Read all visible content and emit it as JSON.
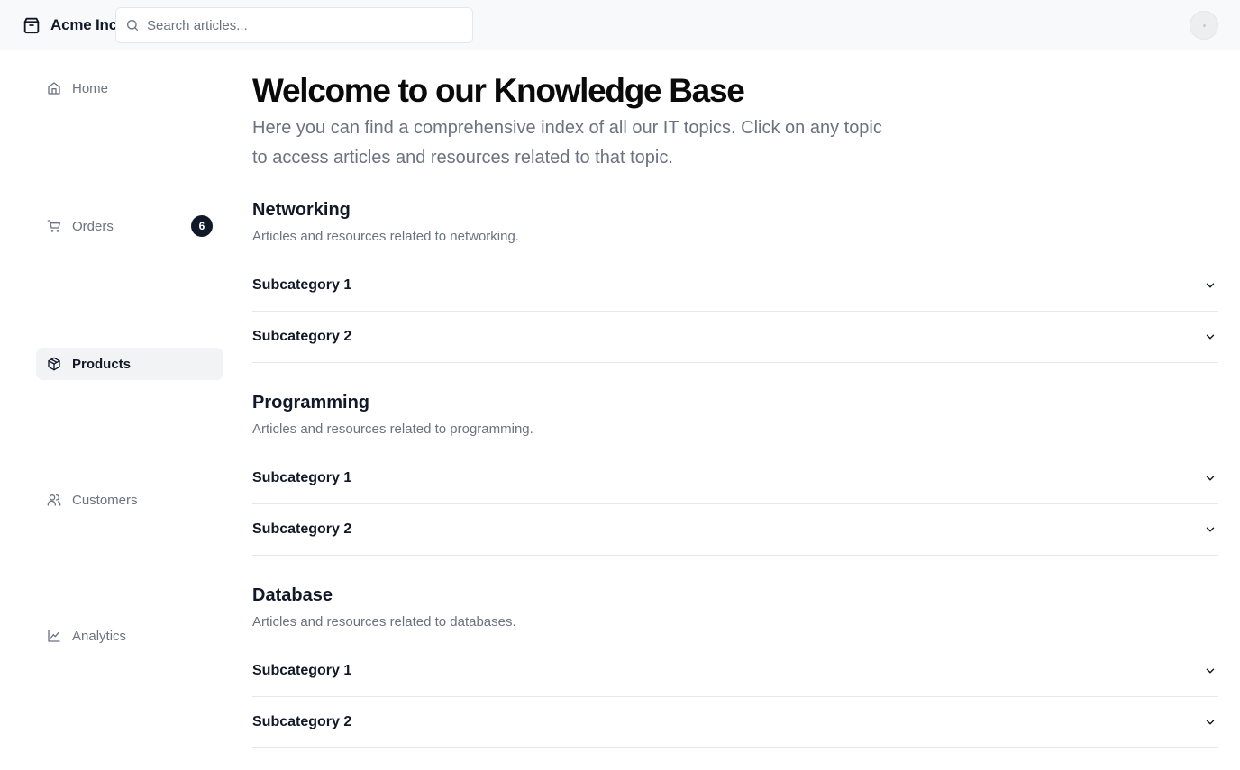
{
  "header": {
    "brand": "Acme Inc",
    "search_placeholder": "Search articles..."
  },
  "sidebar": {
    "items": [
      {
        "label": "Home",
        "icon": "home-icon",
        "active": false
      },
      {
        "label": "Orders",
        "icon": "cart-icon",
        "active": false,
        "badge": "6"
      },
      {
        "label": "Products",
        "icon": "package-icon",
        "active": true
      },
      {
        "label": "Customers",
        "icon": "users-icon",
        "active": false
      },
      {
        "label": "Analytics",
        "icon": "line-chart-icon",
        "active": false
      }
    ]
  },
  "main": {
    "title": "Welcome to our Knowledge Base",
    "intro": "Here you can find a comprehensive index of all our IT topics. Click on any topic to access articles and resources related to that topic.",
    "sections": [
      {
        "title": "Networking",
        "description": "Articles and resources related to networking.",
        "subcategories": [
          "Subcategory 1",
          "Subcategory 2"
        ]
      },
      {
        "title": "Programming",
        "description": "Articles and resources related to programming.",
        "subcategories": [
          "Subcategory 1",
          "Subcategory 2"
        ]
      },
      {
        "title": "Database",
        "description": "Articles and resources related to databases.",
        "subcategories": [
          "Subcategory 1",
          "Subcategory 2"
        ]
      }
    ]
  }
}
